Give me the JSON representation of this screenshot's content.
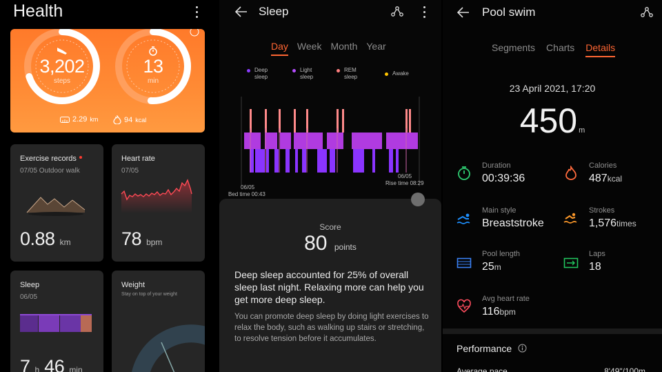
{
  "health": {
    "title": "Health",
    "steps": {
      "value": "3,202",
      "unit": "steps"
    },
    "minutes": {
      "value": "13",
      "unit": "min"
    },
    "distance": {
      "value": "2.29",
      "unit": "km"
    },
    "calories": {
      "value": "94",
      "unit": "kcal"
    },
    "exercise": {
      "title": "Exercise records",
      "subtitle": "07/05 Outdoor walk",
      "value": "0.88",
      "unit": "km"
    },
    "heart": {
      "title": "Heart rate",
      "subtitle": "07/05",
      "value": "78",
      "unit": "bpm"
    },
    "sleep": {
      "title": "Sleep",
      "subtitle": "06/05",
      "hours": "7",
      "h_unit": "h",
      "minutes": "46",
      "m_unit": "min"
    },
    "weight": {
      "title": "Weight",
      "subtitle": "Stay on top of your weight"
    }
  },
  "sleep_screen": {
    "title": "Sleep",
    "tabs": [
      "Day",
      "Week",
      "Month",
      "Year"
    ],
    "active_tab": "Day",
    "legend": [
      {
        "label": "Deep\nsleep",
        "color": "#8b3dff"
      },
      {
        "label": "Light\nsleep",
        "color": "#b54dff"
      },
      {
        "label": "REM\nsleep",
        "color": "#ff7f7f"
      },
      {
        "label": "Awake",
        "color": "#ffc400"
      }
    ],
    "bed_date": "06/05",
    "bed_time": "Bed time 00:43",
    "rise_date": "06/05",
    "rise_time": "Rise time 08:29",
    "score_label": "Score",
    "score_value": "80",
    "score_unit": "points",
    "paragraph1": "Deep sleep accounted for 25% of overall sleep last night. Relaxing more can help you get more deep sleep.",
    "paragraph2": "You can promote deep sleep by doing light exercises to relax the body, such as walking up stairs or stretching, to resolve tension before it accumulates."
  },
  "pool_swim": {
    "title": "Pool swim",
    "tabs": [
      "Segments",
      "Charts",
      "Details"
    ],
    "active_tab": "Details",
    "date": "23 April 2021, 17:20",
    "distance": "450",
    "distance_unit": "m",
    "metrics": {
      "duration": {
        "label": "Duration",
        "value": "00:39:36",
        "unit": ""
      },
      "calories": {
        "label": "Calories",
        "value": "487",
        "unit": "kcal"
      },
      "main_style": {
        "label": "Main style",
        "value": "Breaststroke",
        "unit": ""
      },
      "strokes": {
        "label": "Strokes",
        "value": "1,576",
        "unit": "times"
      },
      "pool_length": {
        "label": "Pool length",
        "value": "25",
        "unit": "m"
      },
      "laps": {
        "label": "Laps",
        "value": "18",
        "unit": ""
      },
      "avg_heart_rate": {
        "label": "Avg heart rate",
        "value": "116",
        "unit": "bpm"
      }
    },
    "performance_label": "Performance",
    "next_row_label": "Average pace",
    "next_row_value": "8'49\"/100m"
  },
  "colors": {
    "accent": "#ff6633",
    "card": "#262626",
    "orange": "#ff8a34"
  }
}
